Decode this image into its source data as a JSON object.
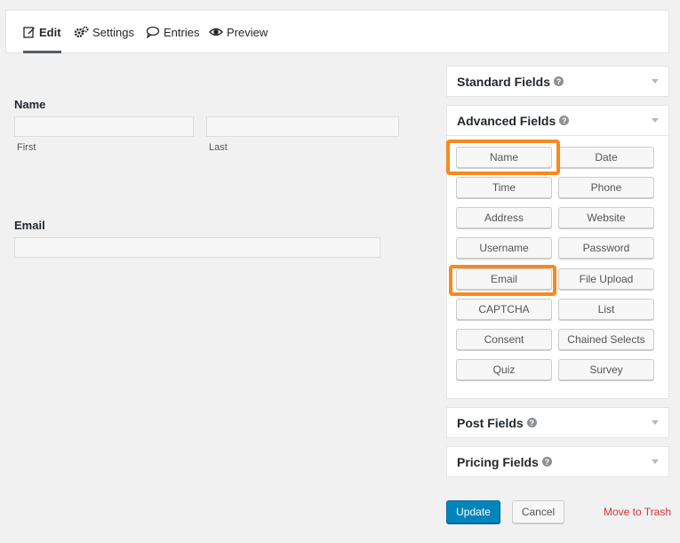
{
  "tabs": [
    {
      "label": "Edit",
      "icon": "edit-icon"
    },
    {
      "label": "Settings",
      "icon": "gears-icon"
    },
    {
      "label": "Entries",
      "icon": "comment-icon"
    },
    {
      "label": "Preview",
      "icon": "eye-icon"
    }
  ],
  "form": {
    "name_label": "Name",
    "first_label": "First",
    "last_label": "Last",
    "first_value": "",
    "last_value": "",
    "email_label": "Email",
    "email_value": ""
  },
  "panels": {
    "standard": "Standard Fields",
    "advanced": "Advanced Fields",
    "post": "Post Fields",
    "pricing": "Pricing Fields"
  },
  "advanced_buttons": [
    "Name",
    "Date",
    "Time",
    "Phone",
    "Address",
    "Website",
    "Username",
    "Password",
    "Email",
    "File Upload",
    "CAPTCHA",
    "List",
    "Consent",
    "Chained Selects",
    "Quiz",
    "Survey"
  ],
  "actions": {
    "update": "Update",
    "cancel": "Cancel",
    "trash": "Move to Trash"
  },
  "colors": {
    "highlight": "#f78a1e",
    "primary": "#0085ba",
    "danger": "#dc3232"
  }
}
